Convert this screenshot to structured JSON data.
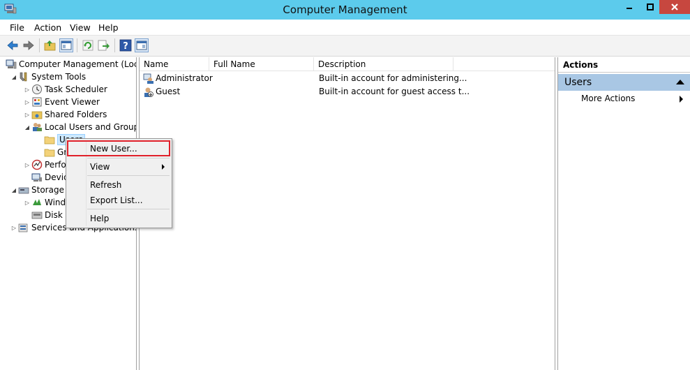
{
  "window": {
    "title": "Computer Management"
  },
  "menu": [
    "File",
    "Action",
    "View",
    "Help"
  ],
  "tree": {
    "root": "Computer Management (Local",
    "system_tools": "System Tools",
    "task_scheduler": "Task Scheduler",
    "event_viewer": "Event Viewer",
    "shared_folders": "Shared Folders",
    "local_users_groups": "Local Users and Groups",
    "users": "Users",
    "groups": "Groups",
    "performance": "Performance",
    "device_manager": "Device Manager",
    "storage": "Storage",
    "windows_server_backup": "Windows Server Backup",
    "disk_management": "Disk Management",
    "services_apps": "Services and Applications"
  },
  "list": {
    "columns": [
      "Name",
      "Full Name",
      "Description"
    ],
    "rows": [
      {
        "name": "Administrator",
        "full_name": "",
        "description": "Built-in account for administering..."
      },
      {
        "name": "Guest",
        "full_name": "",
        "description": "Built-in account for guest access t..."
      }
    ]
  },
  "actions": {
    "header": "Actions",
    "section": "Users",
    "more_actions": "More Actions"
  },
  "context_menu": {
    "new_user": "New User...",
    "view": "View",
    "refresh": "Refresh",
    "export_list": "Export List...",
    "help": "Help"
  },
  "colors": {
    "titlebar": "#5ccbec",
    "close_button": "#c7473f",
    "actions_section": "#a9c7e4",
    "highlight_box": "#e0202a"
  }
}
